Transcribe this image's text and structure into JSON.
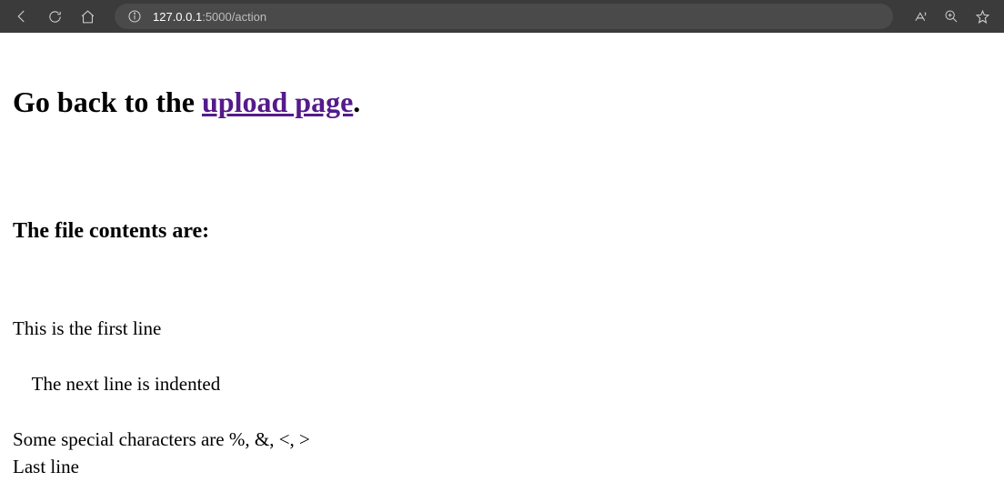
{
  "browser": {
    "url_host": "127.0.0.1",
    "url_port_path": ":5000/action"
  },
  "heading": {
    "prefix": "Go back to the ",
    "link_text": "upload page",
    "suffix": "."
  },
  "subheading": "The file contents are:",
  "file_contents": "This is the first line\n\n    The next line is indented\n\nSome special characters are %, &, <, >\nLast line"
}
